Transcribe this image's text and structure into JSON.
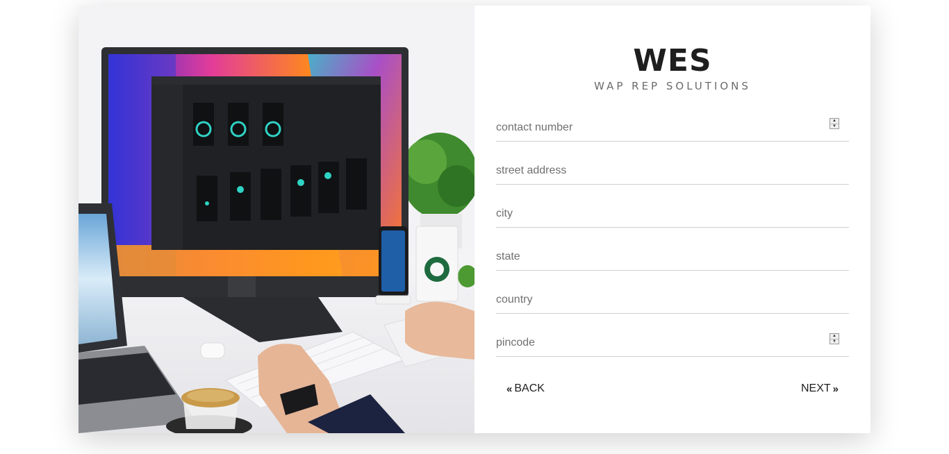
{
  "brand": {
    "title": "WES",
    "subtitle": "WAP REP SOLUTIONS"
  },
  "form": {
    "fields": [
      {
        "placeholder": "contact number",
        "type": "number",
        "value": ""
      },
      {
        "placeholder": "street address",
        "type": "text",
        "value": ""
      },
      {
        "placeholder": "city",
        "type": "text",
        "value": ""
      },
      {
        "placeholder": "state",
        "type": "text",
        "value": ""
      },
      {
        "placeholder": "country",
        "type": "text",
        "value": ""
      },
      {
        "placeholder": "pincode",
        "type": "number",
        "value": ""
      }
    ]
  },
  "nav": {
    "back_label": "BACK",
    "next_label": "NEXT",
    "back_icon": "double-chevron-left-icon",
    "next_icon": "double-chevron-right-icon"
  },
  "colors": {
    "text_dark": "#1e1e1e",
    "subtitle": "#6b6b6b",
    "underline": "#cfcfcf",
    "accent_teal": "#2fd3c4"
  }
}
